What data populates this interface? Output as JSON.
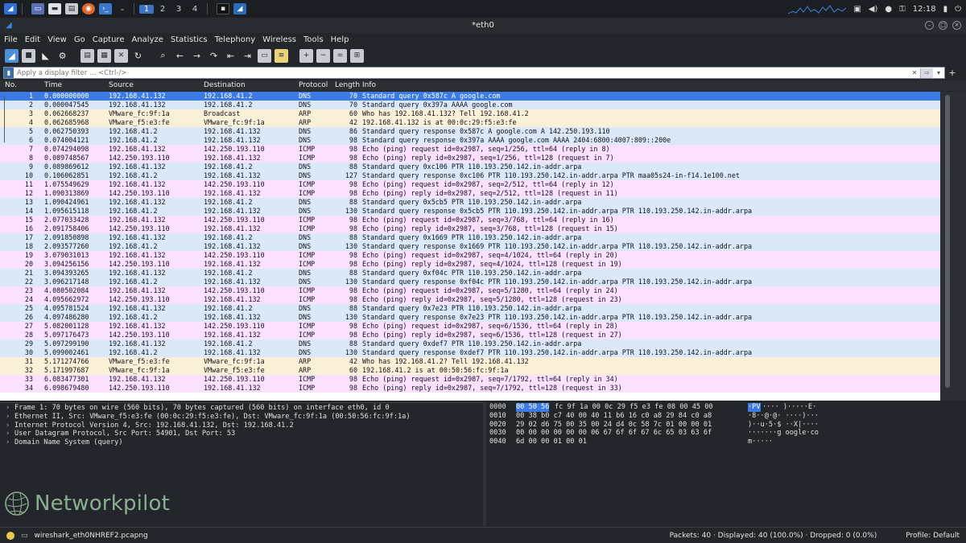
{
  "taskbar": {
    "workspaces": [
      "1",
      "2",
      "3",
      "4"
    ],
    "clock": "12:18"
  },
  "window": {
    "title": "*eth0"
  },
  "menu": [
    "File",
    "Edit",
    "View",
    "Go",
    "Capture",
    "Analyze",
    "Statistics",
    "Telephony",
    "Wireless",
    "Tools",
    "Help"
  ],
  "toolbar_icons": [
    "shark-fin-start-icon",
    "stop-square-icon",
    "restart-fin-icon",
    "options-gear-icon",
    "open-folder-icon",
    "save-file-icon",
    "close-file-icon",
    "reload-icon",
    "find-icon",
    "go-back-icon",
    "go-forward-icon",
    "go-to-packet-icon",
    "first-packet-icon",
    "last-packet-icon",
    "autoscroll-icon",
    "colorize-icon",
    "zoom-in-icon",
    "zoom-out-icon",
    "normal-size-icon",
    "resize-columns-icon"
  ],
  "filter": {
    "placeholder": "Apply a display filter … <Ctrl-/>"
  },
  "columns": {
    "no": "No.",
    "time": "Time",
    "source": "Source",
    "destination": "Destination",
    "protocol": "Protocol",
    "length": "Length",
    "info": "Info"
  },
  "colors": {
    "dns": "#dae8f8",
    "arp": "#faf0d7",
    "icmp": "#fce0ff",
    "selected": "#3b7be3",
    "background": "#23262b"
  },
  "packets": [
    {
      "no": "1",
      "time": "0.000000000",
      "src": "192.168.41.132",
      "dst": "192.168.41.2",
      "proto": "DNS",
      "len": "70",
      "info": "Standard query 0x587c A google.com",
      "sel": true
    },
    {
      "no": "2",
      "time": "0.000047545",
      "src": "192.168.41.132",
      "dst": "192.168.41.2",
      "proto": "DNS",
      "len": "70",
      "info": "Standard query 0x397a AAAA google.com"
    },
    {
      "no": "3",
      "time": "0.062668237",
      "src": "VMware_fc:9f:1a",
      "dst": "Broadcast",
      "proto": "ARP",
      "len": "60",
      "info": "Who has 192.168.41.132? Tell 192.168.41.2"
    },
    {
      "no": "4",
      "time": "0.062685968",
      "src": "VMware_f5:e3:fe",
      "dst": "VMware_fc:9f:1a",
      "proto": "ARP",
      "len": "42",
      "info": "192.168.41.132 is at 00:0c:29:f5:e3:fe"
    },
    {
      "no": "5",
      "time": "0.062750393",
      "src": "192.168.41.2",
      "dst": "192.168.41.132",
      "proto": "DNS",
      "len": "86",
      "info": "Standard query response 0x587c A google.com A 142.250.193.110"
    },
    {
      "no": "6",
      "time": "0.074004121",
      "src": "192.168.41.2",
      "dst": "192.168.41.132",
      "proto": "DNS",
      "len": "98",
      "info": "Standard query response 0x397a AAAA google.com AAAA 2404:6800:4007:809::200e"
    },
    {
      "no": "7",
      "time": "0.074294098",
      "src": "192.168.41.132",
      "dst": "142.250.193.110",
      "proto": "ICMP",
      "len": "98",
      "info": "Echo (ping) request  id=0x2987, seq=1/256, ttl=64 (reply in 8)"
    },
    {
      "no": "8",
      "time": "0.089748567",
      "src": "142.250.193.110",
      "dst": "192.168.41.132",
      "proto": "ICMP",
      "len": "98",
      "info": "Echo (ping) reply    id=0x2987, seq=1/256, ttl=128 (request in 7)"
    },
    {
      "no": "9",
      "time": "0.089869612",
      "src": "192.168.41.132",
      "dst": "192.168.41.2",
      "proto": "DNS",
      "len": "88",
      "info": "Standard query 0xc106 PTR 110.193.250.142.in-addr.arpa"
    },
    {
      "no": "10",
      "time": "0.106062851",
      "src": "192.168.41.2",
      "dst": "192.168.41.132",
      "proto": "DNS",
      "len": "127",
      "info": "Standard query response 0xc106 PTR 110.193.250.142.in-addr.arpa PTR maa05s24-in-f14.1e100.net"
    },
    {
      "no": "11",
      "time": "1.075549629",
      "src": "192.168.41.132",
      "dst": "142.250.193.110",
      "proto": "ICMP",
      "len": "98",
      "info": "Echo (ping) request  id=0x2987, seq=2/512, ttl=64 (reply in 12)"
    },
    {
      "no": "12",
      "time": "1.090313869",
      "src": "142.250.193.110",
      "dst": "192.168.41.132",
      "proto": "ICMP",
      "len": "98",
      "info": "Echo (ping) reply    id=0x2987, seq=2/512, ttl=128 (request in 11)"
    },
    {
      "no": "13",
      "time": "1.090424961",
      "src": "192.168.41.132",
      "dst": "192.168.41.2",
      "proto": "DNS",
      "len": "88",
      "info": "Standard query 0x5cb5 PTR 110.193.250.142.in-addr.arpa"
    },
    {
      "no": "14",
      "time": "1.095615118",
      "src": "192.168.41.2",
      "dst": "192.168.41.132",
      "proto": "DNS",
      "len": "130",
      "info": "Standard query response 0x5cb5 PTR 110.193.250.142.in-addr.arpa PTR 110.193.250.142.in-addr.arpa"
    },
    {
      "no": "15",
      "time": "2.077033428",
      "src": "192.168.41.132",
      "dst": "142.250.193.110",
      "proto": "ICMP",
      "len": "98",
      "info": "Echo (ping) request  id=0x2987, seq=3/768, ttl=64 (reply in 16)"
    },
    {
      "no": "16",
      "time": "2.091758406",
      "src": "142.250.193.110",
      "dst": "192.168.41.132",
      "proto": "ICMP",
      "len": "98",
      "info": "Echo (ping) reply    id=0x2987, seq=3/768, ttl=128 (request in 15)"
    },
    {
      "no": "17",
      "time": "2.091850898",
      "src": "192.168.41.132",
      "dst": "192.168.41.2",
      "proto": "DNS",
      "len": "88",
      "info": "Standard query 0x1669 PTR 110.193.250.142.in-addr.arpa"
    },
    {
      "no": "18",
      "time": "2.093577260",
      "src": "192.168.41.2",
      "dst": "192.168.41.132",
      "proto": "DNS",
      "len": "130",
      "info": "Standard query response 0x1669 PTR 110.193.250.142.in-addr.arpa PTR 110.193.250.142.in-addr.arpa"
    },
    {
      "no": "19",
      "time": "3.079031013",
      "src": "192.168.41.132",
      "dst": "142.250.193.110",
      "proto": "ICMP",
      "len": "98",
      "info": "Echo (ping) request  id=0x2987, seq=4/1024, ttl=64 (reply in 20)"
    },
    {
      "no": "20",
      "time": "3.094256156",
      "src": "142.250.193.110",
      "dst": "192.168.41.132",
      "proto": "ICMP",
      "len": "98",
      "info": "Echo (ping) reply    id=0x2987, seq=4/1024, ttl=128 (request in 19)"
    },
    {
      "no": "21",
      "time": "3.094393265",
      "src": "192.168.41.132",
      "dst": "192.168.41.2",
      "proto": "DNS",
      "len": "88",
      "info": "Standard query 0xf04c PTR 110.193.250.142.in-addr.arpa"
    },
    {
      "no": "22",
      "time": "3.096217148",
      "src": "192.168.41.2",
      "dst": "192.168.41.132",
      "proto": "DNS",
      "len": "130",
      "info": "Standard query response 0xf04c PTR 110.193.250.142.in-addr.arpa PTR 110.193.250.142.in-addr.arpa"
    },
    {
      "no": "23",
      "time": "4.080502084",
      "src": "192.168.41.132",
      "dst": "142.250.193.110",
      "proto": "ICMP",
      "len": "98",
      "info": "Echo (ping) request  id=0x2987, seq=5/1280, ttl=64 (reply in 24)"
    },
    {
      "no": "24",
      "time": "4.095662972",
      "src": "142.250.193.110",
      "dst": "192.168.41.132",
      "proto": "ICMP",
      "len": "98",
      "info": "Echo (ping) reply    id=0x2987, seq=5/1280, ttl=128 (request in 23)"
    },
    {
      "no": "25",
      "time": "4.095781524",
      "src": "192.168.41.132",
      "dst": "192.168.41.2",
      "proto": "DNS",
      "len": "88",
      "info": "Standard query 0x7e23 PTR 110.193.250.142.in-addr.arpa"
    },
    {
      "no": "26",
      "time": "4.097486280",
      "src": "192.168.41.2",
      "dst": "192.168.41.132",
      "proto": "DNS",
      "len": "130",
      "info": "Standard query response 0x7e23 PTR 110.193.250.142.in-addr.arpa PTR 110.193.250.142.in-addr.arpa"
    },
    {
      "no": "27",
      "time": "5.082001128",
      "src": "192.168.41.132",
      "dst": "142.250.193.110",
      "proto": "ICMP",
      "len": "98",
      "info": "Echo (ping) request  id=0x2987, seq=6/1536, ttl=64 (reply in 28)"
    },
    {
      "no": "28",
      "time": "5.097176473",
      "src": "142.250.193.110",
      "dst": "192.168.41.132",
      "proto": "ICMP",
      "len": "98",
      "info": "Echo (ping) reply    id=0x2987, seq=6/1536, ttl=128 (request in 27)"
    },
    {
      "no": "29",
      "time": "5.097299190",
      "src": "192.168.41.132",
      "dst": "192.168.41.2",
      "proto": "DNS",
      "len": "88",
      "info": "Standard query 0xdef7 PTR 110.193.250.142.in-addr.arpa"
    },
    {
      "no": "30",
      "time": "5.099002461",
      "src": "192.168.41.2",
      "dst": "192.168.41.132",
      "proto": "DNS",
      "len": "130",
      "info": "Standard query response 0xdef7 PTR 110.193.250.142.in-addr.arpa PTR 110.193.250.142.in-addr.arpa"
    },
    {
      "no": "31",
      "time": "5.171274766",
      "src": "VMware_f5:e3:fe",
      "dst": "VMware_fc:9f:1a",
      "proto": "ARP",
      "len": "42",
      "info": "Who has 192.168.41.2? Tell 192.168.41.132"
    },
    {
      "no": "32",
      "time": "5.171997687",
      "src": "VMware_fc:9f:1a",
      "dst": "VMware_f5:e3:fe",
      "proto": "ARP",
      "len": "60",
      "info": "192.168.41.2 is at 00:50:56:fc:9f:1a"
    },
    {
      "no": "33",
      "time": "6.083477301",
      "src": "192.168.41.132",
      "dst": "142.250.193.110",
      "proto": "ICMP",
      "len": "98",
      "info": "Echo (ping) request  id=0x2987, seq=7/1792, ttl=64 (reply in 34)"
    },
    {
      "no": "34",
      "time": "6.098679480",
      "src": "142.250.193.110",
      "dst": "192.168.41.132",
      "proto": "ICMP",
      "len": "98",
      "info": "Echo (ping) reply    id=0x2987, seq=7/1792, ttl=128 (request in 33)"
    }
  ],
  "details": [
    "Frame 1: 70 bytes on wire (560 bits), 70 bytes captured (560 bits) on interface eth0, id 0",
    "Ethernet II, Src: VMware_f5:e3:fe (00:0c:29:f5:e3:fe), Dst: VMware_fc:9f:1a (00:50:56:fc:9f:1a)",
    "Internet Protocol Version 4, Src: 192.168.41.132, Dst: 192.168.41.2",
    "User Datagram Protocol, Src Port: 54901, Dst Port: 53",
    "Domain Name System (query)"
  ],
  "hex": [
    {
      "off": "0000",
      "hl": "00 50 56",
      "rest": "fc 9f 1a 00 0c  29 f5 e3 fe 08 00 45 00",
      "ascii_hl": "·PV",
      "ascii_rest": "····  )·····E·"
    },
    {
      "off": "0010",
      "hl": "",
      "rest": "00 38 b0 c7 40 00 40 11  b6 16 c0 a8 29 84 c0 a8",
      "ascii_hl": "",
      "ascii_rest": "·8··@·@·  ····)···"
    },
    {
      "off": "0020",
      "hl": "",
      "rest": "29 02 d6 75 00 35 00 24  d4 0c 58 7c 01 00 00 01",
      "ascii_hl": "",
      "ascii_rest": ")··u·5·$  ··X|····"
    },
    {
      "off": "0030",
      "hl": "",
      "rest": "00 00 00 00 00 00 06 67  6f 6f 67 6c 65 03 63 6f",
      "ascii_hl": "",
      "ascii_rest": "·······g oogle·co"
    },
    {
      "off": "0040",
      "hl": "",
      "rest": "6d 00 00 01 00 01",
      "ascii_hl": "",
      "ascii_rest": "m·····"
    }
  ],
  "watermark": "Networkpilot",
  "status": {
    "file": "wireshark_eth0NHREF2.pcapng",
    "counts": "Packets: 40 · Displayed: 40 (100.0%) · Dropped: 0 (0.0%)",
    "profile": "Profile: Default"
  }
}
